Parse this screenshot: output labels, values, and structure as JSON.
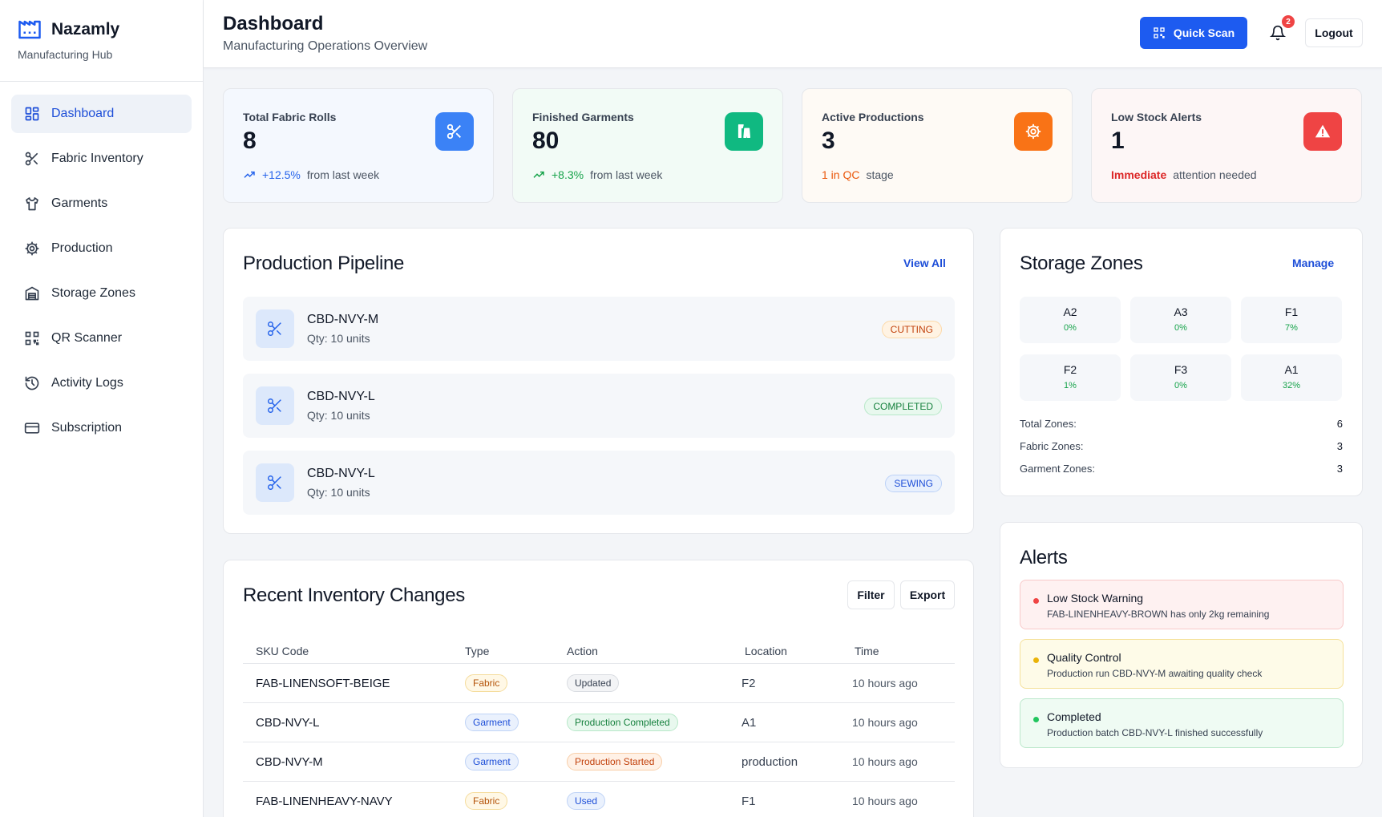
{
  "brand": {
    "name": "Nazamly",
    "subtitle": "Manufacturing Hub"
  },
  "nav": [
    {
      "label": "Dashboard",
      "icon": "dashboard-icon",
      "active": true
    },
    {
      "label": "Fabric Inventory",
      "icon": "scissors-icon"
    },
    {
      "label": "Garments",
      "icon": "shirt-icon"
    },
    {
      "label": "Production",
      "icon": "gear-icon"
    },
    {
      "label": "Storage Zones",
      "icon": "warehouse-icon"
    },
    {
      "label": "QR Scanner",
      "icon": "qr-icon"
    },
    {
      "label": "Activity Logs",
      "icon": "history-icon"
    },
    {
      "label": "Subscription",
      "icon": "credit-card-icon"
    }
  ],
  "header": {
    "title": "Dashboard",
    "subtitle": "Manufacturing Operations Overview",
    "quick_scan": "Quick Scan",
    "notification_count": "2",
    "logout": "Logout"
  },
  "stats": [
    {
      "label": "Total Fabric Rolls",
      "value": "8",
      "delta": "+12.5%",
      "foot": "from last week",
      "color": "#3b82f6"
    },
    {
      "label": "Finished Garments",
      "value": "80",
      "delta": "+8.3%",
      "foot": "from last week",
      "color": "#10b981"
    },
    {
      "label": "Active Productions",
      "value": "3",
      "delta": "1 in QC",
      "foot": "stage",
      "color": "#f97316"
    },
    {
      "label": "Low Stock Alerts",
      "value": "1",
      "delta": "Immediate",
      "foot": "attention needed",
      "color": "#ef4444"
    }
  ],
  "pipeline": {
    "title": "Production Pipeline",
    "link": "View All",
    "items": [
      {
        "sku": "CBD-NVY-M",
        "qty": "Qty: 10 units",
        "status": "CUTTING"
      },
      {
        "sku": "CBD-NVY-L",
        "qty": "Qty: 10 units",
        "status": "COMPLETED"
      },
      {
        "sku": "CBD-NVY-L",
        "qty": "Qty: 10 units",
        "status": "SEWING"
      }
    ]
  },
  "inventory": {
    "title": "Recent Inventory Changes",
    "filter": "Filter",
    "export": "Export",
    "columns": [
      "SKU Code",
      "Type",
      "Action",
      "Location",
      "Time"
    ],
    "rows": [
      {
        "sku": "FAB-LINENSOFT-BEIGE",
        "type": "Fabric",
        "action": "Updated",
        "location": "F2",
        "time": "10 hours ago"
      },
      {
        "sku": "CBD-NVY-L",
        "type": "Garment",
        "action": "Production Completed",
        "location": "A1",
        "time": "10 hours ago"
      },
      {
        "sku": "CBD-NVY-M",
        "type": "Garment",
        "action": "Production Started",
        "location": "production",
        "time": "10 hours ago"
      },
      {
        "sku": "FAB-LINENHEAVY-NAVY",
        "type": "Fabric",
        "action": "Used",
        "location": "F1",
        "time": "10 hours ago"
      }
    ]
  },
  "storage": {
    "title": "Storage Zones",
    "link": "Manage",
    "zones": [
      {
        "name": "A2",
        "pct": "0%"
      },
      {
        "name": "A3",
        "pct": "0%"
      },
      {
        "name": "F1",
        "pct": "7%"
      },
      {
        "name": "F2",
        "pct": "1%"
      },
      {
        "name": "F3",
        "pct": "0%"
      },
      {
        "name": "A1",
        "pct": "32%"
      }
    ],
    "summary": [
      {
        "label": "Total Zones:",
        "value": "6"
      },
      {
        "label": "Fabric Zones:",
        "value": "3"
      },
      {
        "label": "Garment Zones:",
        "value": "3"
      }
    ]
  },
  "alerts": {
    "title": "Alerts",
    "items": [
      {
        "title": "Low Stock Warning",
        "text": "FAB-LINENHEAVY-BROWN has only 2kg remaining",
        "level": "danger"
      },
      {
        "title": "Quality Control",
        "text": "Production run CBD-NVY-M awaiting quality check",
        "level": "warning"
      },
      {
        "title": "Completed",
        "text": "Production batch CBD-NVY-L finished successfully",
        "level": "success"
      }
    ]
  }
}
